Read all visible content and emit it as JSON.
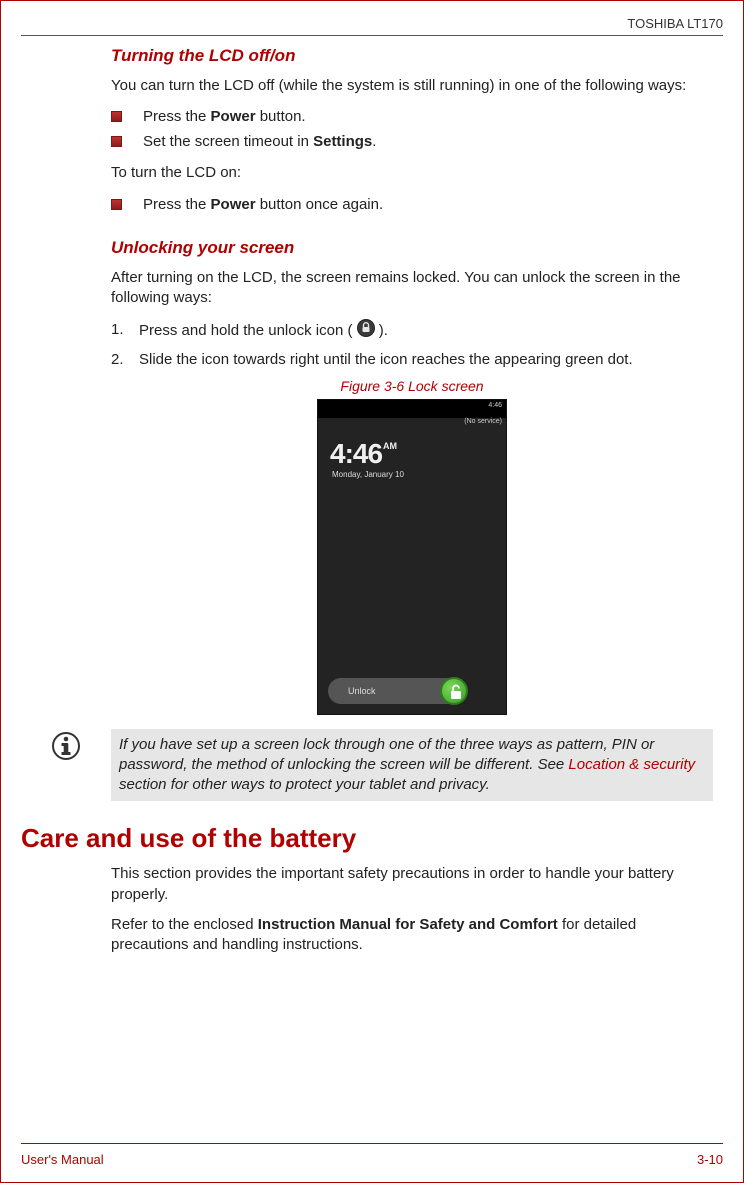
{
  "header": {
    "product": "TOSHIBA LT170"
  },
  "sections": {
    "lcd": {
      "title": "Turning the LCD off/on",
      "intro": "You can turn the LCD off (while the system is still running) in one of the following ways:",
      "bullets": {
        "b1_pre": "Press the ",
        "b1_bold": "Power",
        "b1_post": " button.",
        "b2_pre": "Set the screen timeout in ",
        "b2_bold": "Settings",
        "b2_post": "."
      },
      "turn_on_intro": "To turn the LCD on:",
      "turn_on_bullet_pre": "Press the ",
      "turn_on_bullet_bold": "Power",
      "turn_on_bullet_post": " button once again."
    },
    "unlock": {
      "title": "Unlocking your screen",
      "intro": "After turning on the LCD, the screen remains locked. You can unlock the screen in the following ways:",
      "steps": {
        "s1_pre": "Press and hold the unlock icon ( ",
        "s1_post": " ).",
        "s2": "Slide the icon towards right until the icon reaches the appearing green dot."
      },
      "figure_caption": "Figure 3-6 Lock screen",
      "lockscreen": {
        "status_time": "4:46",
        "no_service": "(No service)",
        "time_main": "4:46",
        "time_ampm": "AM",
        "date": "Monday, January 10",
        "unlock_label": "Unlock"
      },
      "note": {
        "pre": "If you have set up a screen lock through one of the three ways as pattern, PIN or password, the method of unlocking the screen will be different. See ",
        "link": "Location & security",
        "post": " section for other ways to protect your tablet and privacy."
      }
    },
    "battery": {
      "title": "Care and use of the battery",
      "p1": "This section provides the important safety precautions in order to handle your battery properly.",
      "p2_pre": "Refer to the enclosed ",
      "p2_bold": "Instruction Manual for Safety and Comfort",
      "p2_post": " for detailed precautions and handling instructions."
    }
  },
  "footer": {
    "left": "User's Manual",
    "right": "3-10"
  }
}
